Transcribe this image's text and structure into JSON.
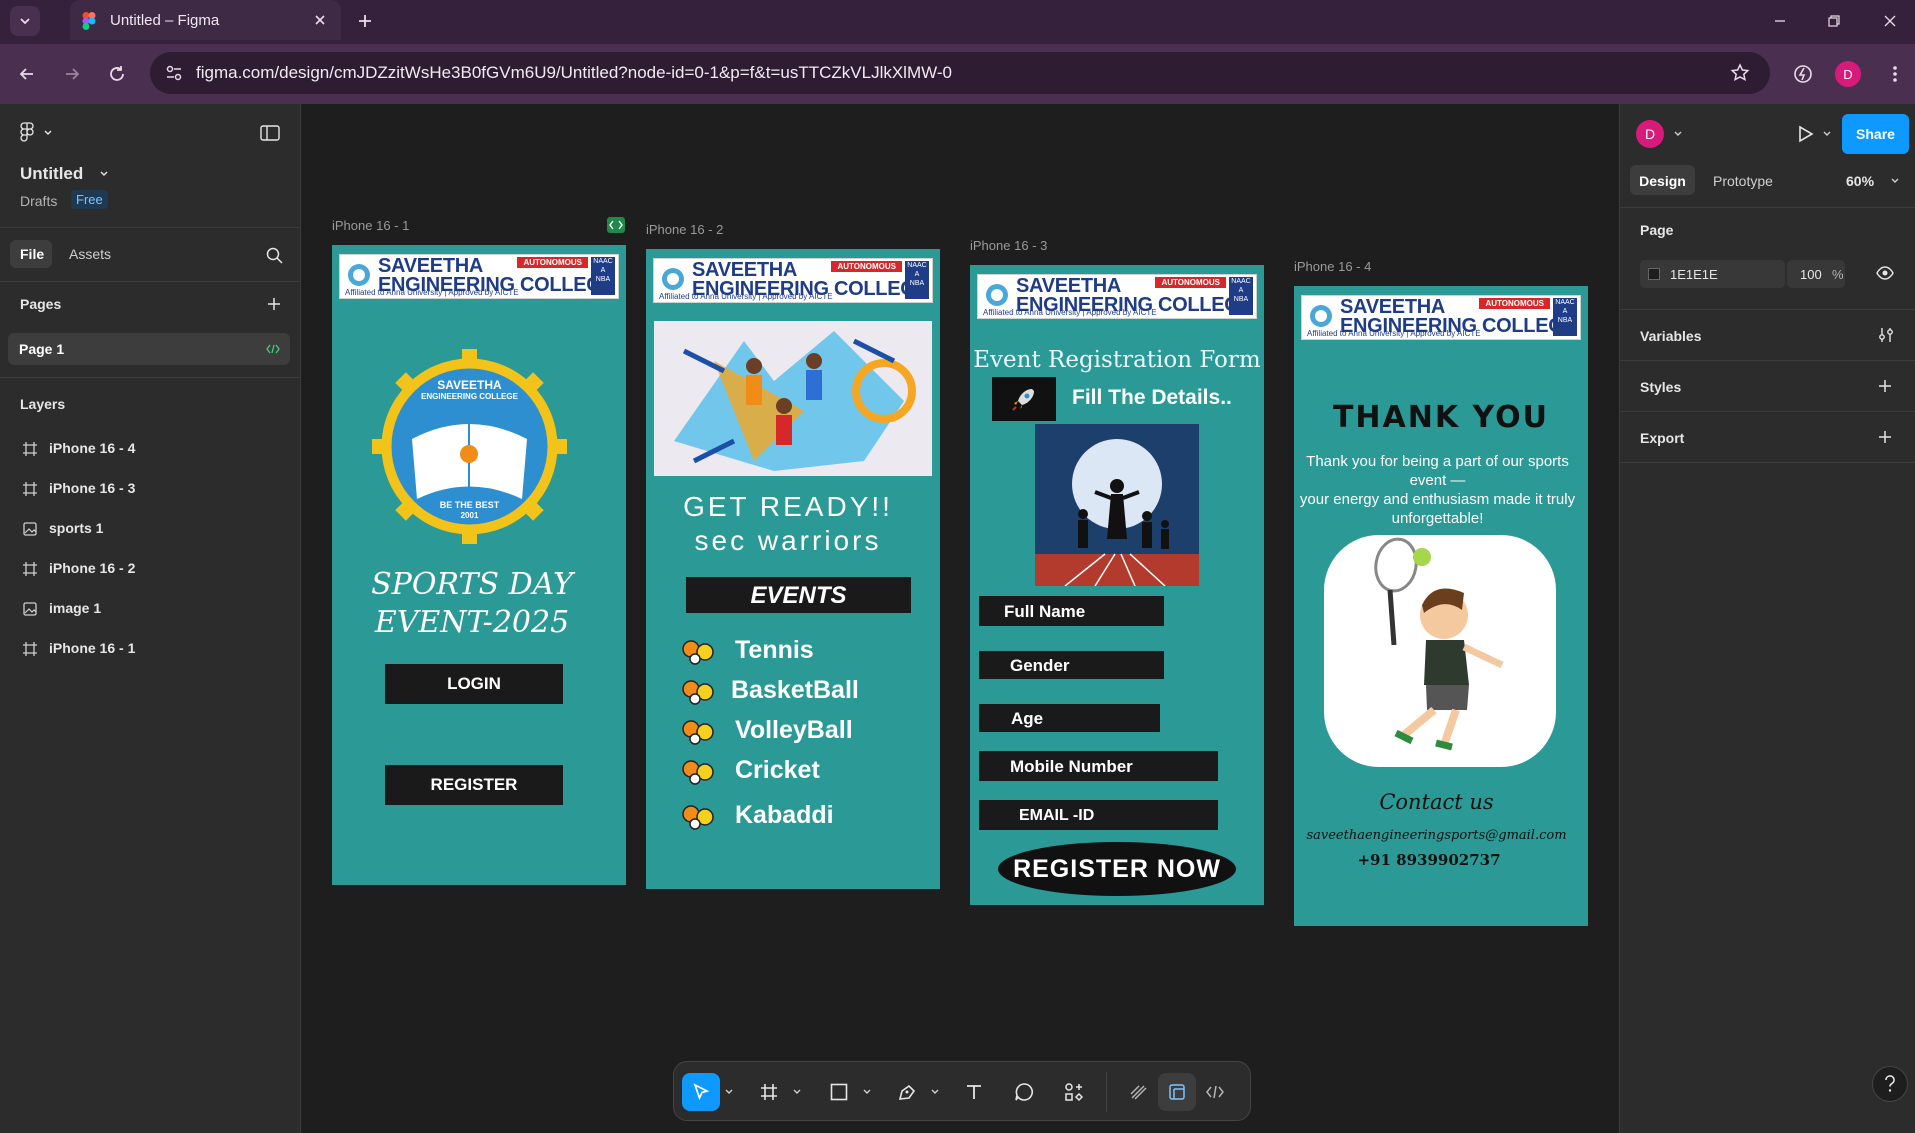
{
  "browser": {
    "tab_title": "Untitled – Figma",
    "url": "figma.com/design/cmJDZzitWsHe3B0fGVm6U9/Untitled?node-id=0-1&p=f&t=usTTCZkVLJlkXlMW-0",
    "profile_initial": "D",
    "accent": "#d81b7a"
  },
  "left_panel": {
    "file_name": "Untitled",
    "drafts": "Drafts",
    "plan": "Free",
    "tab_file": "File",
    "tab_assets": "Assets",
    "pages_heading": "Pages",
    "current_page": "Page 1",
    "layers_heading": "Layers",
    "layers": [
      {
        "name": "iPhone 16 - 4",
        "type": "frame"
      },
      {
        "name": "iPhone 16 - 3",
        "type": "frame"
      },
      {
        "name": "sports 1",
        "type": "image"
      },
      {
        "name": "iPhone 16 - 2",
        "type": "frame"
      },
      {
        "name": "image 1",
        "type": "image"
      },
      {
        "name": "iPhone 16 - 1",
        "type": "frame"
      }
    ]
  },
  "right_panel": {
    "avatar_initial": "D",
    "share": "Share",
    "tab_design": "Design",
    "tab_prototype": "Prototype",
    "zoom": "60%",
    "page_heading": "Page",
    "page_color": "1E1E1E",
    "page_opacity": "100",
    "percent": "%",
    "variables": "Variables",
    "styles": "Styles",
    "export": "Export"
  },
  "college": {
    "name_line1": "SAVEETHA",
    "name_line2": "ENGINEERING COLLEGE",
    "affiliation": "Affiliated to Anna University | Approved by AICTE",
    "badge": "AUTONOMOUS",
    "naac": "NAAC A",
    "nba": "NBA"
  },
  "frames": {
    "f1": {
      "label": "iPhone 16 - 1",
      "logo_top": "SAVEETHA",
      "logo_mid": "ENGINEERING COLLEGE",
      "logo_motto": "BE THE BEST",
      "logo_year": "2001",
      "title_line1": "SPORTS DAY",
      "title_line2": "EVENT-2025",
      "login": "LOGIN",
      "register": "REGISTER"
    },
    "f2": {
      "label": "iPhone 16 - 2",
      "ready_line1": "GET READY!!",
      "ready_line2": "sec warriors",
      "events_heading": "EVENTS",
      "events": [
        "Tennis",
        "BasketBall",
        "VolleyBall",
        "Cricket",
        "Kabaddi"
      ]
    },
    "f3": {
      "label": "iPhone 16 - 3",
      "form_title": "Event Registration Form",
      "fill": "Fill The Details..",
      "fields": [
        "Full Name",
        "Gender",
        "Age",
        "Mobile Number",
        "EMAIL -ID"
      ],
      "register_now": "REGISTER NOW"
    },
    "f4": {
      "label": "iPhone 16 - 4",
      "thank_you": "THANK YOU",
      "message_line1": "Thank you for being a part of our sports",
      "message_line2": "event —",
      "message_line3": "your energy and enthusiasm made it truly",
      "message_line4": "unforgettable!",
      "contact_heading": "Contact us",
      "email": "saveethaengineeringsports@gmail.com",
      "phone": "+91 8939902737"
    }
  },
  "colors": {
    "frame_teal": "#2b9995",
    "figma_blue": "#0d99ff",
    "header_navy": "#1f3c87",
    "badge_red": "#d62828"
  }
}
